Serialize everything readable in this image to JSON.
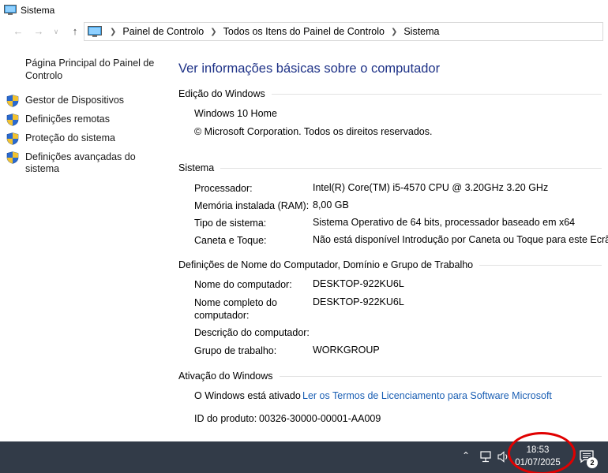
{
  "window": {
    "title": "Sistema"
  },
  "breadcrumb": [
    "Painel de Controlo",
    "Todos os Itens do Painel de Controlo",
    "Sistema"
  ],
  "sidebar": {
    "home": "Página Principal do Painel de Controlo",
    "items": [
      {
        "label": "Gestor de Dispositivos"
      },
      {
        "label": "Definições remotas"
      },
      {
        "label": "Proteção do sistema"
      },
      {
        "label": "Definições avançadas do sistema"
      }
    ]
  },
  "main": {
    "heading": "Ver informações básicas sobre o computador",
    "edition": {
      "title": "Edição do Windows",
      "name": "Windows 10 Home",
      "copyright": "© Microsoft Corporation. Todos os direitos reservados."
    },
    "system": {
      "title": "Sistema",
      "rows": [
        {
          "label": "Processador:",
          "value": "Intel(R) Core(TM) i5-4570 CPU @ 3.20GHz   3.20 GHz"
        },
        {
          "label": "Memória instalada (RAM):",
          "value": "8,00 GB"
        },
        {
          "label": "Tipo de sistema:",
          "value": "Sistema Operativo de 64 bits, processador baseado em x64"
        },
        {
          "label": "Caneta e Toque:",
          "value": "Não está disponível Introdução por Caneta ou Toque para este Ecrã"
        }
      ]
    },
    "computer_name": {
      "title": "Definições de Nome do Computador, Domínio e Grupo de Trabalho",
      "rows": [
        {
          "label": "Nome do computador:",
          "value": "DESKTOP-922KU6L"
        },
        {
          "label": "Nome completo do computador:",
          "value": "DESKTOP-922KU6L"
        },
        {
          "label": "Descrição do computador:",
          "value": ""
        },
        {
          "label": "Grupo de trabalho:",
          "value": "WORKGROUP"
        }
      ]
    },
    "activation": {
      "title": "Ativação do Windows",
      "status": "O Windows está ativado",
      "license_link": "Ler os Termos de Licenciamento para Software Microsoft",
      "product_id_label": "ID do produto:",
      "product_id": "00326-30000-00001-AA009"
    }
  },
  "taskbar": {
    "time": "18:53",
    "date": "01/07/2025",
    "notification_count": "2",
    "annotation_color": "#e00000"
  }
}
